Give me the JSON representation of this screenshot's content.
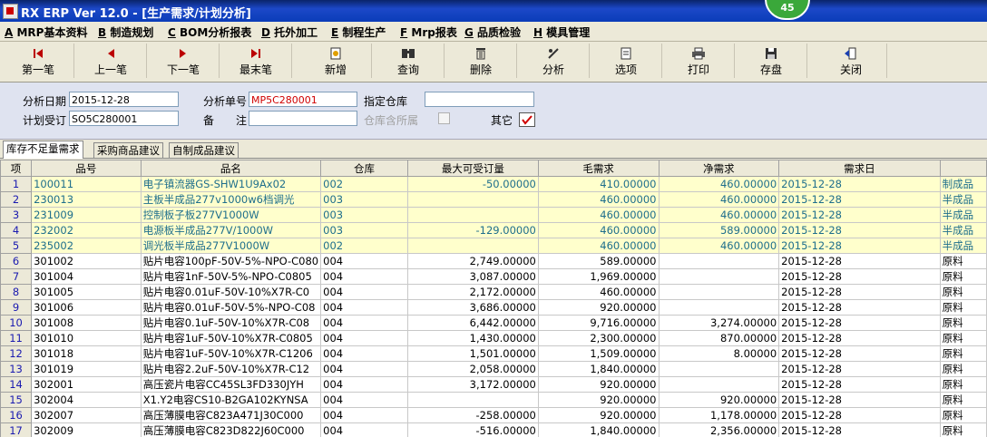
{
  "window": {
    "title": "RX ERP Ver 12.0 - [生产需求/计划分析]",
    "badge": "45"
  },
  "menu": [
    {
      "key": "A",
      "label": " MRP基本资料"
    },
    {
      "key": "B",
      "label": " 制造规划"
    },
    {
      "key": "C",
      "label": " BOM分析报表"
    },
    {
      "key": "D",
      "label": " 托外加工"
    },
    {
      "key": "E",
      "label": " 制程生产"
    },
    {
      "key": "F",
      "label": " Mrp报表"
    },
    {
      "key": "G",
      "label": " 品质检验"
    },
    {
      "key": "H",
      "label": " 模具管理"
    }
  ],
  "toolbar": {
    "first": "第一笔",
    "prev": "上一笔",
    "next": "下一笔",
    "last": "最末笔",
    "add": "新增",
    "query": "查询",
    "delete": "删除",
    "analyze": "分析",
    "options": "选项",
    "print": "打印",
    "save": "存盘",
    "close": "关闭"
  },
  "form": {
    "date_label": "分析日期",
    "date_value": "2015-12-28",
    "no_label": "分析单号",
    "no_value": "MP5C280001",
    "warehouse_label": "指定仓库",
    "warehouse_value": "",
    "plan_label": "计划受订",
    "plan_value": "SO5C280001",
    "remark_label": "备　　注",
    "remark_value": "",
    "wh_all_label": "仓库含所属",
    "other_label": "其它"
  },
  "tabs": [
    "库存不足量需求",
    "采购商品建议",
    "自制成品建议"
  ],
  "table": {
    "headers": [
      "项",
      "品号",
      "品名",
      "仓库",
      "最大可受订量",
      "毛需求",
      "净需求",
      "需求日",
      ""
    ],
    "rows": [
      [
        "1",
        "100011",
        "电子镇流器GS-SHW1U9Ax02",
        "002",
        "-50.00000",
        "410.00000",
        "460.00000",
        "2015-12-28",
        "制成品"
      ],
      [
        "2",
        "230013",
        "主板半成品277v1000w6档调光",
        "003",
        "",
        "460.00000",
        "460.00000",
        "2015-12-28",
        "半成品"
      ],
      [
        "3",
        "231009",
        "控制板子板277V1000W",
        "003",
        "",
        "460.00000",
        "460.00000",
        "2015-12-28",
        "半成品"
      ],
      [
        "4",
        "232002",
        "电源板半成品277V/1000W",
        "003",
        "-129.00000",
        "460.00000",
        "589.00000",
        "2015-12-28",
        "半成品"
      ],
      [
        "5",
        "235002",
        "调光板半成品277V1000W",
        "002",
        "",
        "460.00000",
        "460.00000",
        "2015-12-28",
        "半成品"
      ],
      [
        "6",
        "301002",
        "贴片电容100pF-50V-5%-NPO-C080",
        "004",
        "2,749.00000",
        "589.00000",
        "",
        "2015-12-28",
        "原料"
      ],
      [
        "7",
        "301004",
        "贴片电容1nF-50V-5%-NPO-C0805",
        "004",
        "3,087.00000",
        "1,969.00000",
        "",
        "2015-12-28",
        "原料"
      ],
      [
        "8",
        "301005",
        "贴片电容0.01uF-50V-10%X7R-C0",
        "004",
        "2,172.00000",
        "460.00000",
        "",
        "2015-12-28",
        "原料"
      ],
      [
        "9",
        "301006",
        "贴片电容0.01uF-50V-5%-NPO-C08",
        "004",
        "3,686.00000",
        "920.00000",
        "",
        "2015-12-28",
        "原料"
      ],
      [
        "10",
        "301008",
        "贴片电容0.1uF-50V-10%X7R-C08",
        "004",
        "6,442.00000",
        "9,716.00000",
        "3,274.00000",
        "2015-12-28",
        "原料"
      ],
      [
        "11",
        "301010",
        "贴片电容1uF-50V-10%X7R-C0805",
        "004",
        "1,430.00000",
        "2,300.00000",
        "870.00000",
        "2015-12-28",
        "原料"
      ],
      [
        "12",
        "301018",
        "贴片电容1uF-50V-10%X7R-C1206",
        "004",
        "1,501.00000",
        "1,509.00000",
        "8.00000",
        "2015-12-28",
        "原料"
      ],
      [
        "13",
        "301019",
        "贴片电容2.2uF-50V-10%X7R-C12",
        "004",
        "2,058.00000",
        "1,840.00000",
        "",
        "2015-12-28",
        "原料"
      ],
      [
        "14",
        "302001",
        "高压瓷片电容CC45SL3FD330JYH",
        "004",
        "3,172.00000",
        "920.00000",
        "",
        "2015-12-28",
        "原料"
      ],
      [
        "15",
        "302004",
        "X1.Y2电容CS10-B2GA102KYNSA",
        "004",
        "",
        "920.00000",
        "920.00000",
        "2015-12-28",
        "原料"
      ],
      [
        "16",
        "302007",
        "高压薄膜电容C823A471J30C000",
        "004",
        "-258.00000",
        "920.00000",
        "1,178.00000",
        "2015-12-28",
        "原料"
      ],
      [
        "17",
        "302009",
        "高压薄膜电容C823D822J60C000",
        "004",
        "-516.00000",
        "1,840.00000",
        "2,356.00000",
        "2015-12-28",
        "原料"
      ]
    ]
  }
}
